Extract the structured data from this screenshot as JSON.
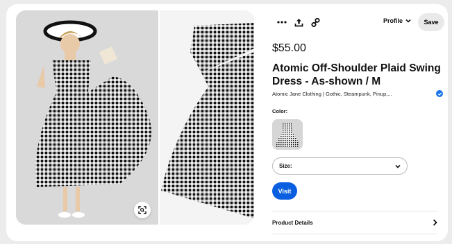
{
  "product": {
    "price": "$55.00",
    "title": "Atomic Off-Shoulder Plaid Swing Dress - As-shown / M",
    "source": "Atomic Jane Clothing | Gothic, Steampunk, Pinup,...",
    "color_label": "Color:",
    "size_label": "Size:",
    "visit_label": "Visit",
    "details_label": "Product Details"
  },
  "toolbar": {
    "profile_label": "Profile",
    "save_label": "Save",
    "icons": [
      "more-icon",
      "share-icon",
      "link-icon"
    ]
  },
  "colors": {
    "accent": "#0a5fe0",
    "verified": "#1a73e8",
    "save_bg": "#e9e9e9"
  }
}
